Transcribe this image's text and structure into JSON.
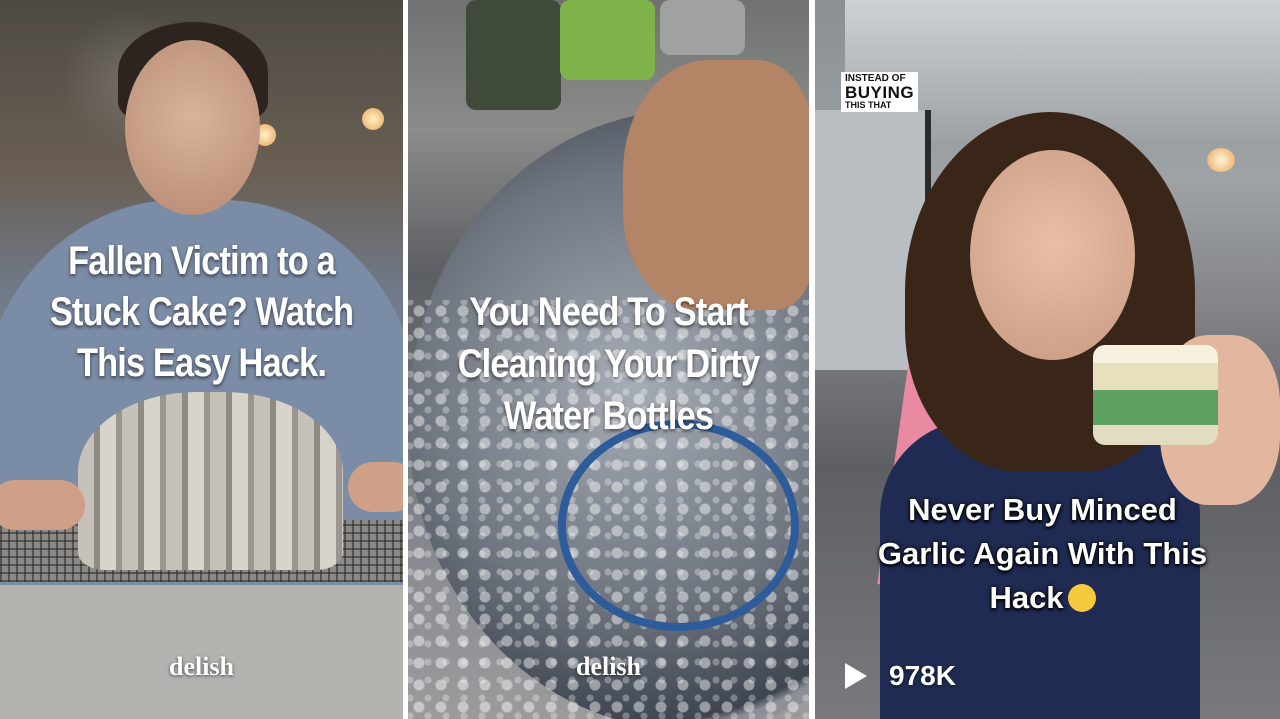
{
  "videos": [
    {
      "title_lines": [
        "Fallen Victim to a",
        "Stuck Cake? Watch",
        "This Easy Hack."
      ],
      "brand": "delish"
    },
    {
      "title_lines": [
        "You Need To Start",
        "Cleaning Your Dirty",
        "Water Bottles"
      ],
      "brand": "delish"
    },
    {
      "badge": {
        "top": "INSTEAD OF",
        "main": "BUYING",
        "bottom": "THIS THAT"
      },
      "title_lines": [
        "Never Buy Minced",
        "Garlic Again With This",
        "Hack"
      ],
      "views": "978K",
      "icons": {
        "play": "play-icon",
        "emoji": "worried-face-emoji"
      }
    }
  ]
}
